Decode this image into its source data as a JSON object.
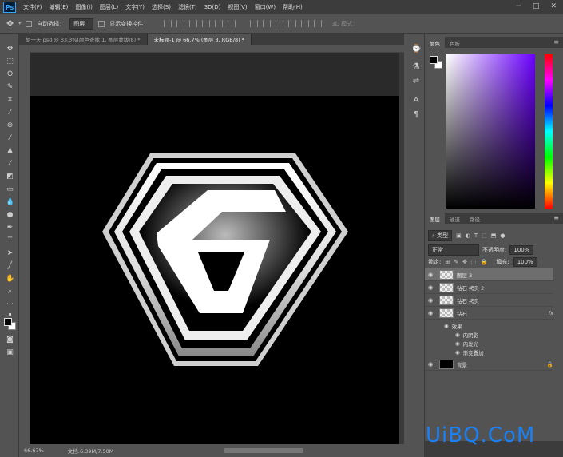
{
  "app": {
    "logo": "Ps"
  },
  "menu": [
    "文件(F)",
    "编辑(E)",
    "图像(I)",
    "图层(L)",
    "文字(Y)",
    "选择(S)",
    "滤镜(T)",
    "3D(D)",
    "视图(V)",
    "窗口(W)",
    "帮助(H)"
  ],
  "window_controls": [
    "−",
    "□",
    "✕"
  ],
  "options": {
    "auto_select": "自动选择：",
    "target": "图层",
    "show_transform": "显示变换控件",
    "mode_3d": "3D 模式："
  },
  "tabs": [
    "胡一天.psd @ 33.3%(颜色查找 1, 图层蒙版/8) *",
    "未标题-1 @ 66.7% (图层 3, RGB/8) *"
  ],
  "status": {
    "zoom": "66.67%",
    "doc": "文档:6.39M/7.50M"
  },
  "color_panel": {
    "tabs": [
      "颜色",
      "色板"
    ]
  },
  "layers_panel": {
    "tabs": [
      "图层",
      "通道",
      "路径"
    ],
    "filter": "类型",
    "blend_mode": "正常",
    "opacity_label": "不透明度:",
    "opacity": "100%",
    "lock_label": "锁定:",
    "fill_label": "填充:",
    "fill": "100%",
    "layers": [
      {
        "name": "图层 3",
        "selected": true
      },
      {
        "name": "钻石 拷贝 2",
        "selected": false
      },
      {
        "name": "钻石 拷贝",
        "selected": false
      },
      {
        "name": "钻石",
        "selected": false,
        "fx": "fx"
      }
    ],
    "effects_label": "效果",
    "effects": [
      "内阴影",
      "内发光",
      "渐变叠加"
    ],
    "background": "背景"
  },
  "watermark": "UiBQ.CoM"
}
